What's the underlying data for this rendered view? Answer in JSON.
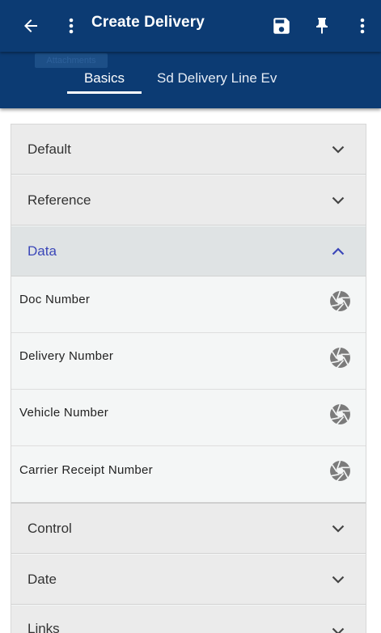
{
  "appbar": {
    "title": "Create Delivery",
    "back_icon": "arrow-left-icon",
    "menu_icon": "more-vert-icon",
    "save_icon": "save-icon",
    "pin_icon": "pin-icon",
    "overflow_icon": "more-vert-icon"
  },
  "tabs": {
    "ghost_label": "Attachments",
    "items": [
      {
        "label": "Basics",
        "active": true
      },
      {
        "label": "Sd Delivery Line Ev",
        "active": false
      }
    ]
  },
  "sections": {
    "default": {
      "label": "Default"
    },
    "reference": {
      "label": "Reference"
    },
    "data": {
      "label": "Data",
      "fields": [
        {
          "label": "Doc Number"
        },
        {
          "label": "Delivery Number"
        },
        {
          "label": "Vehicle Number"
        },
        {
          "label": "Carrier Receipt Number"
        }
      ]
    },
    "control": {
      "label": "Control"
    },
    "date": {
      "label": "Date"
    },
    "links": {
      "label": "Links"
    }
  },
  "colors": {
    "primary": "#0c3b73",
    "accent": "#3b47b8",
    "section_bg": "#ebebeb",
    "panel_bg": "#f4f6f6"
  }
}
